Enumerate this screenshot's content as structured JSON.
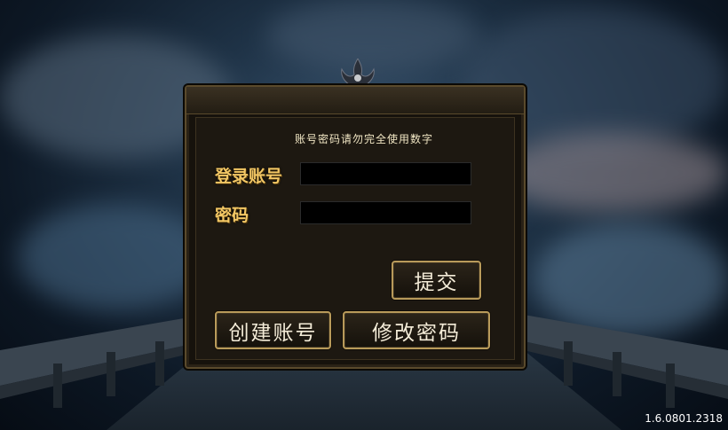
{
  "login": {
    "hint": "账号密码请勿完全使用数字",
    "account_label": "登录账号",
    "account_value": "",
    "password_label": "密码",
    "password_value": "",
    "submit_label": "提交",
    "create_label": "创建账号",
    "change_password_label": "修改密码"
  },
  "footer": {
    "version": "1.6.0801.2318"
  },
  "colors": {
    "label_gold": "#f3c764",
    "panel_border": "#5a4a2c",
    "button_border": "#b89a5a",
    "field_bg": "#000000"
  },
  "icons": {
    "top_ornament": "dragon-crest-icon"
  }
}
